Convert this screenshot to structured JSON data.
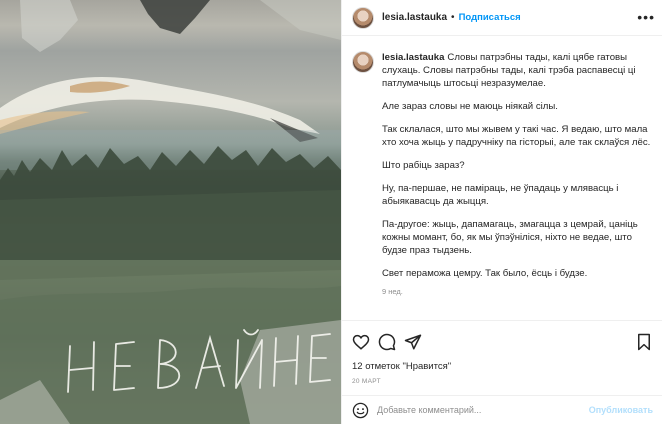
{
  "post": {
    "username": "lesia.lastauka",
    "follow_label": "Подписаться",
    "separator": "•",
    "caption": {
      "first_line": "Словы патрэбны тады, калі цябе гатовы слухаць. Словы патрэбны тады, калі трэба распавесці ці патлумачыць штосьці незразумелае.",
      "paragraphs": [
        "Але зараз словы не маюць ніякай сілы.",
        "Так склалася, што мы жывем у такі час. Я ведаю, што мала хто хоча жыць у падручніку па гісторыі, але так склаўся лёс.",
        "Што рабіць зараз?",
        "Ну, па-першае, не паміраць, не ўпадаць у млявасць і абыякавасць да жыцця.",
        "Па-другое: жыць, дапамагаць, змагацца з цемрай, цаніць кожны момант, бо, як мы ўпэўніліся, ніхто не ведае, што будзе праз тыдзень.",
        "Свет пераможа цемру. Так было, ёсць і будзе."
      ]
    },
    "age": "9 нед.",
    "likes": "12 отметок \"Нравится\"",
    "date": "20 МАРТ",
    "comment_placeholder": "Добавьте комментарий...",
    "publish_label": "Опубликовать",
    "image_text": "НЕ ВАЙНЕ"
  },
  "icons": {
    "more": "more-options-icon",
    "like": "heart-icon",
    "comment": "comment-icon",
    "share": "paper-plane-icon",
    "save": "bookmark-icon",
    "emoji": "smiley-icon"
  },
  "colors": {
    "link_blue": "#0095f6",
    "publish_disabled": "#b2dffc",
    "secondary_text": "#8e8e8e"
  }
}
